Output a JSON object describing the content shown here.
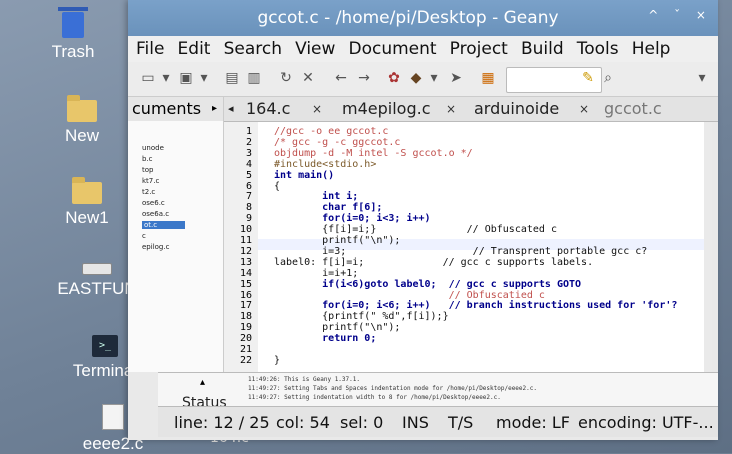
{
  "desktop": {
    "icons": [
      {
        "name": "trash",
        "label": "Trash"
      },
      {
        "name": "new",
        "label": "New"
      },
      {
        "name": "new1",
        "label": "New1"
      },
      {
        "name": "eastfun",
        "label": "EASTFUN"
      },
      {
        "name": "terminal",
        "label": "Terminal"
      },
      {
        "name": "eeee2",
        "label": "eeee2.c"
      }
    ],
    "under_labels": [
      "164.c",
      "ee"
    ]
  },
  "window": {
    "title": "gccot.c - /home/pi/Desktop - Geany",
    "controls": "^ ˇ ×",
    "menu": [
      "File",
      "Edit",
      "Search",
      "View",
      "Document",
      "Project",
      "Build",
      "Tools",
      "Help"
    ],
    "search_placeholder": "",
    "sidebar": {
      "header": "cuments",
      "items": [
        "unode",
        "b.c",
        "top",
        "kt7.c",
        "t2.c",
        "ose6.c",
        "ose6a.c",
        "ot.c",
        "c",
        "epilog.c"
      ]
    },
    "tabs": [
      {
        "label": "164.c",
        "close": "×"
      },
      {
        "label": "m4epilog.c",
        "close": "×"
      },
      {
        "label": "arduinoide",
        "close": "×"
      },
      {
        "label": "gccot.c",
        "close": ""
      }
    ],
    "code_lines": [
      {
        "n": "1",
        "text": "//gcc -o ee gccot.c",
        "cls": "c-comment"
      },
      {
        "n": "2",
        "text": "/* gcc -g -c ggccot.c",
        "cls": "c-comment"
      },
      {
        "n": "3",
        "text": "objdump -d -M intel -S gccot.o */",
        "cls": "c-comment"
      },
      {
        "n": "4",
        "text": "#include<stdio.h>",
        "cls": "c-pre"
      },
      {
        "n": "5",
        "text": "int main()",
        "cls": "c-kw"
      },
      {
        "n": "6",
        "text": "{",
        "cls": "c-plain"
      },
      {
        "n": "7",
        "text": "        int i;",
        "cls": "c-kw"
      },
      {
        "n": "8",
        "text": "        char f[6];",
        "cls": "c-kw"
      },
      {
        "n": "9",
        "text": "        for(i=0; i<3; i++)",
        "cls": "c-kw"
      },
      {
        "n": "10",
        "text": "        {f[i]=i;}               // Obfuscated c",
        "cls": "c-plain"
      },
      {
        "n": "11",
        "text": "        printf(\"\\n\");",
        "cls": "c-plain"
      },
      {
        "n": "12",
        "text": "        i=3;                     // Transprent portable gcc c?",
        "cls": "c-plain"
      },
      {
        "n": "13",
        "text": "label0: f[i]=i;             // gcc c supports labels.",
        "cls": "c-plain"
      },
      {
        "n": "14",
        "text": "        i=i+1;",
        "cls": "c-plain"
      },
      {
        "n": "15",
        "text": "        if(i<6)goto label0;  // gcc c supports GOTO",
        "cls": "c-kw"
      },
      {
        "n": "16",
        "text": "                             // Obfuscatied c",
        "cls": "c-comment"
      },
      {
        "n": "17",
        "text": "        for(i=0; i<6; i++)   // branch instructions used for 'for'?",
        "cls": "c-kw"
      },
      {
        "n": "18",
        "text": "        {printf(\" %d\",f[i]);}",
        "cls": "c-plain"
      },
      {
        "n": "19",
        "text": "        printf(\"\\n\");",
        "cls": "c-plain"
      },
      {
        "n": "20",
        "text": "        return 0;",
        "cls": "c-kw"
      },
      {
        "n": "21",
        "text": "",
        "cls": "c-plain"
      },
      {
        "n": "22",
        "text": "}",
        "cls": "c-plain"
      }
    ],
    "messages": [
      "11:49:26: This is Geany 1.37.1.",
      "11:49:27: Setting Tabs and Spaces indentation mode for /home/pi/Desktop/eeee2.c.",
      "11:49:27: Setting indentation width to 8 for /home/pi/Desktop/eeee2.c."
    ],
    "status_label": "Status",
    "statusbar": {
      "line": "line: 12 / 25",
      "col": "col: 54",
      "sel": "sel: 0",
      "ins": "INS",
      "ts": "T/S",
      "mode": "mode: LF",
      "encoding": "encoding: UTF-..."
    }
  }
}
